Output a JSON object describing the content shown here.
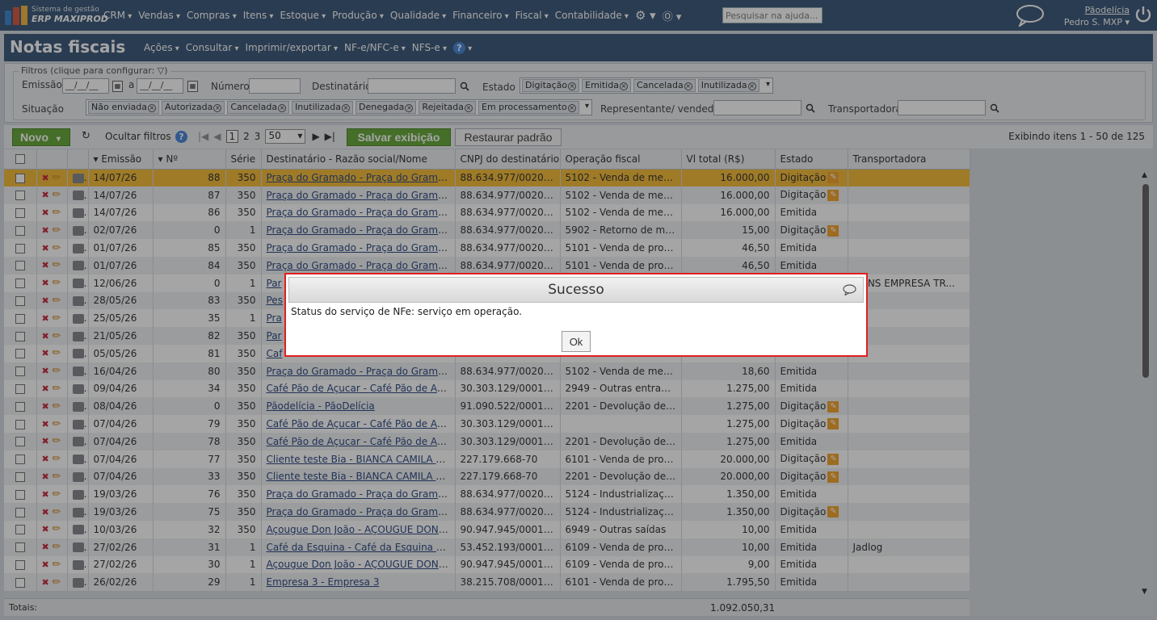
{
  "app": {
    "brand_small": "Sistema de gestão",
    "brand_big": "ERP MAXIPROD",
    "menu": [
      "CRM",
      "Vendas",
      "Compras",
      "Itens",
      "Estoque",
      "Produção",
      "Qualidade",
      "Financeiro",
      "Fiscal",
      "Contabilidade"
    ],
    "help_placeholder": "Pesquisar na ajuda...",
    "company": "Pãodelícia",
    "user": "Pedro S. MXP"
  },
  "page": {
    "title": "Notas fiscais",
    "menu": [
      "Ações",
      "Consultar",
      "Imprimir/exportar",
      "NF-e/NFC-e",
      "NFS-e"
    ],
    "help_glyph": "?"
  },
  "filters": {
    "title": "Filtros (clique para configurar:",
    "emissao_label": "Emissão",
    "date_placeholder": "__/__/__",
    "a_label": "a",
    "numero_label": "Número",
    "destinatario_label": "Destinatário",
    "estado_label": "Estado",
    "estado_tags": [
      "Digitação",
      "Emitida",
      "Cancelada",
      "Inutilizada"
    ],
    "situacao_label": "Situação",
    "situacao_tags": [
      "Não enviada",
      "Autorizada",
      "Cancelada",
      "Inutilizada",
      "Denegada",
      "Rejeitada",
      "Em processamento"
    ],
    "representante_label": "Representante/ vendedor",
    "transportadora_label": "Transportadora"
  },
  "toolbar": {
    "new_label": "Novo",
    "hide_filters_label": "Ocultar filtros",
    "pages": [
      "1",
      "2",
      "3"
    ],
    "page_size": "50",
    "save_view_label": "Salvar exibição",
    "restore_label": "Restaurar padrão",
    "showing_text": "Exibindo itens 1 - 50 de 125"
  },
  "grid": {
    "columns": [
      "Emissão",
      "Nº",
      "Série",
      "Destinatário - Razão social/Nome",
      "CNPJ do destinatário",
      "Operação fiscal",
      "Vl total (R$)",
      "Estado",
      "Transportadora"
    ],
    "rows": [
      [
        "14/07/26",
        "88",
        "350",
        "Praça do Gramado - Praça do Gramado ...",
        "88.634.977/0020-74",
        "5102 - Venda de merca...",
        "16.000,00",
        "Digitação",
        ""
      ],
      [
        "14/07/26",
        "87",
        "350",
        "Praça do Gramado - Praça do Gramado ...",
        "88.634.977/0020-74",
        "5102 - Venda de merca...",
        "16.000,00",
        "Digitação",
        ""
      ],
      [
        "14/07/26",
        "86",
        "350",
        "Praça do Gramado - Praça do Gramado ...",
        "88.634.977/0020-74",
        "5102 - Venda de merca...",
        "16.000,00",
        "Emitida",
        ""
      ],
      [
        "02/07/26",
        "0",
        "1",
        "Praça do Gramado - Praça do Gramado ...",
        "88.634.977/0020-74",
        "5902 - Retorno de mer...",
        "15,00",
        "Digitação",
        ""
      ],
      [
        "01/07/26",
        "85",
        "350",
        "Praça do Gramado - Praça do Gramado ...",
        "88.634.977/0020-74",
        "5101 - Venda de produ...",
        "46,50",
        "Emitida",
        ""
      ],
      [
        "01/07/26",
        "84",
        "350",
        "Praça do Gramado - Praça do Gramado ...",
        "88.634.977/0020-74",
        "5101 - Venda de produ...",
        "46,50",
        "Emitida",
        ""
      ],
      [
        "12/06/26",
        "0",
        "1",
        "Par",
        "",
        "",
        "",
        "",
        "RTINS EMPRESA TR..."
      ],
      [
        "28/05/26",
        "83",
        "350",
        "Pes",
        "",
        "",
        "",
        "",
        ""
      ],
      [
        "25/05/26",
        "35",
        "1",
        "Pra",
        "",
        "",
        "",
        "",
        ""
      ],
      [
        "21/05/26",
        "82",
        "350",
        "Par",
        "",
        "",
        "",
        "",
        ""
      ],
      [
        "05/05/26",
        "81",
        "350",
        "Caf",
        "",
        "",
        "",
        "",
        ""
      ],
      [
        "16/04/26",
        "80",
        "350",
        "Praça do Gramado - Praça do Gramado ...",
        "88.634.977/0020-74",
        "5102 - Venda de merca...",
        "18,60",
        "Emitida",
        ""
      ],
      [
        "09/04/26",
        "34",
        "350",
        "Café Pão de Açucar - Café Pão de Açucar",
        "30.303.129/0001-30",
        "2949 - Outras entradas",
        "1.275,00",
        "Emitida",
        ""
      ],
      [
        "08/04/26",
        "0",
        "350",
        "Pãodelícia - PãoDelícia",
        "91.090.522/0001-87",
        "2201 - Devolução de v...",
        "1.275,00",
        "Digitação",
        ""
      ],
      [
        "07/04/26",
        "79",
        "350",
        "Café Pão de Açucar - Café Pão de Açucar",
        "30.303.129/0001-30",
        "",
        "1.275,00",
        "Digitação",
        ""
      ],
      [
        "07/04/26",
        "78",
        "350",
        "Café Pão de Açucar - Café Pão de Açucar",
        "30.303.129/0001-30",
        "2201 - Devolução de v...",
        "1.275,00",
        "Emitida",
        ""
      ],
      [
        "07/04/26",
        "77",
        "350",
        "Cliente teste Bia - BIANCA CAMILA DE ...",
        "227.179.668-70",
        "6101 - Venda de produ...",
        "20.000,00",
        "Digitação",
        ""
      ],
      [
        "07/04/26",
        "33",
        "350",
        "Cliente teste Bia - BIANCA CAMILA DE ...",
        "227.179.668-70",
        "2201 - Devolução de v...",
        "20.000,00",
        "Digitação",
        ""
      ],
      [
        "19/03/26",
        "76",
        "350",
        "Praça do Gramado - Praça do Gramado ...",
        "88.634.977/0020-74",
        "5124 - Industrialização...",
        "1.350,00",
        "Emitida",
        ""
      ],
      [
        "19/03/26",
        "75",
        "350",
        "Praça do Gramado - Praça do Gramado ...",
        "88.634.977/0020-74",
        "5124 - Industrialização...",
        "1.350,00",
        "Digitação",
        ""
      ],
      [
        "10/03/26",
        "32",
        "350",
        "Açougue Don João - AÇOUGUE DON JOAO",
        "90.947.945/0001-08",
        "6949 - Outras saídas",
        "10,00",
        "Emitida",
        ""
      ],
      [
        "27/02/26",
        "31",
        "1",
        "Café da Esquina - Café da Esquina Com...",
        "53.452.193/0001-88",
        "6109 - Venda de produ...",
        "10,00",
        "Emitida",
        "Jadlog"
      ],
      [
        "27/02/26",
        "30",
        "1",
        "Açougue Don João - AÇOUGUE DON JOAO",
        "90.947.945/0001-08",
        "6109 - Venda de produ...",
        "9,00",
        "Emitida",
        ""
      ],
      [
        "26/02/26",
        "29",
        "1",
        "Empresa 3 - Empresa 3",
        "38.215.708/0001-32",
        "6101 - Venda de produ...",
        "1.795,50",
        "Emitida",
        ""
      ]
    ],
    "totals_label": "Totais:",
    "totals_value": "1.092.050,31"
  },
  "dialog": {
    "title": "Sucesso",
    "message": "Status do serviço de NFe: serviço em operação.",
    "ok_label": "Ok"
  },
  "colors": {
    "topbar": "#2c4a6e",
    "highlight_row": "#f4b728",
    "new_button": "#5aa12a",
    "dialog_border": "#e02020"
  }
}
